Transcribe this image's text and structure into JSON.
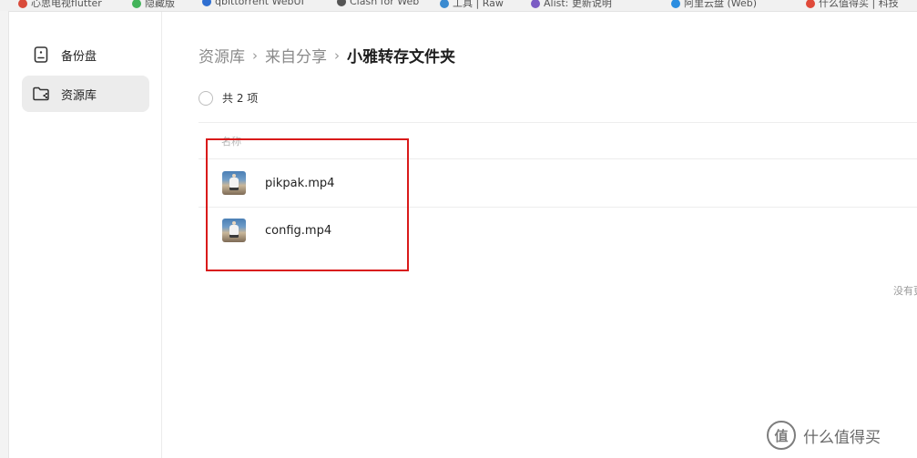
{
  "bookmarks": [
    {
      "label": "心思电视flutter",
      "color": "#d94a3a"
    },
    {
      "label": "隐藏版",
      "color": "#43b35a"
    },
    {
      "label": "qbittorrent WebUI",
      "color": "#2f6fd1"
    },
    {
      "label": "Clash for Web",
      "color": "#555555"
    },
    {
      "label": "工具 | Raw",
      "color": "#3b8bd0"
    },
    {
      "label": "Alist: 更新说明",
      "color": "#7b5cc4"
    },
    {
      "label": "阿里云盘 (Web)",
      "color": "#2b8de0"
    },
    {
      "label": "什么值得买 | 科技",
      "color": "#e04a3a"
    }
  ],
  "sidebar": {
    "items": [
      {
        "label": "备份盘",
        "icon": "backup-drive-icon"
      },
      {
        "label": "资源库",
        "icon": "resource-folder-icon"
      }
    ]
  },
  "breadcrumb": {
    "items": [
      "资源库",
      "来自分享",
      "小雅转存文件夹"
    ],
    "separator": "›"
  },
  "list": {
    "count_label": "共 2 项",
    "column_name": "名称",
    "files": [
      {
        "name": "pikpak.mp4",
        "icon": "video-thumbnail-icon"
      },
      {
        "name": "config.mp4",
        "icon": "video-thumbnail-icon"
      }
    ],
    "empty_hint": "没有更多了"
  },
  "annotation": {
    "color": "#d91a1a"
  },
  "watermark": {
    "logo": "值",
    "text": "什么值得买"
  }
}
